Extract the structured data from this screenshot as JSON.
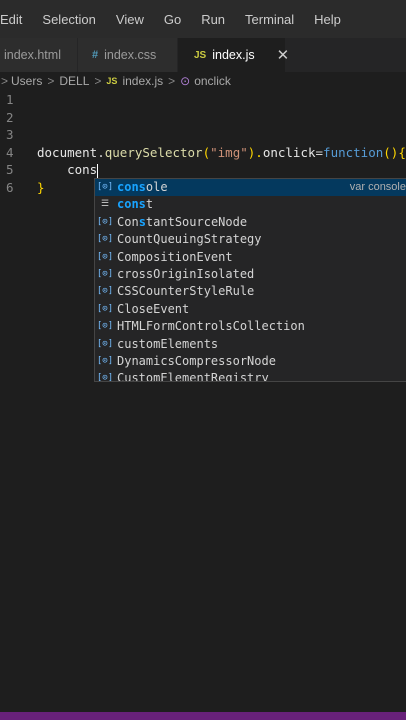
{
  "menubar": {
    "items": [
      "Edit",
      "Selection",
      "View",
      "Go",
      "Run",
      "Terminal",
      "Help"
    ]
  },
  "tabs": [
    {
      "label": "index.html",
      "icon": "",
      "active": false
    },
    {
      "label": "index.css",
      "icon": "#",
      "active": false
    },
    {
      "label": "index.js",
      "icon": "JS",
      "active": true,
      "close": "✕"
    }
  ],
  "breadcrumb": {
    "lead": ">",
    "parts": [
      "Users",
      "DELL",
      "index.js",
      "onclick"
    ],
    "sep": ">",
    "js_icon": "JS",
    "fn_icon": "⊙"
  },
  "editor": {
    "line_numbers": [
      "1",
      "2",
      "3",
      "4",
      "5",
      "6"
    ],
    "line4": {
      "t1": "document",
      "t2": ".",
      "t3": "querySelector",
      "t4": "(",
      "t5": "\"img\"",
      "t6": ").",
      "t7": "onclick",
      "t8": "=",
      "t9": "function",
      "t10": "()",
      "t11": "{"
    },
    "line5": "    cons",
    "line6": "}"
  },
  "suggest": {
    "items": [
      {
        "match": "cons",
        "rest": "ole",
        "icon": "[⊙]",
        "kind": "var",
        "detail": "var console"
      },
      {
        "match": "cons",
        "rest": "t",
        "icon": "☰",
        "kind": "keyword",
        "detail": ""
      },
      {
        "pre": "Con",
        "match": "s",
        "mid": "tantSourceNode",
        "icon": "[⊙]"
      },
      {
        "text": "CountQueuingStrategy",
        "icon": "[⊙]"
      },
      {
        "text": "CompositionEvent",
        "icon": "[⊙]"
      },
      {
        "text": "crossOriginIsolated",
        "icon": "[⊙]"
      },
      {
        "text": "CSSCounterStyleRule",
        "icon": "[⊙]"
      },
      {
        "text": "CloseEvent",
        "icon": "[⊙]"
      },
      {
        "text": "HTMLFormControlsCollection",
        "icon": "[⊙]"
      },
      {
        "text": "customElements",
        "icon": "[⊙]"
      },
      {
        "text": "DynamicsCompressorNode",
        "icon": "[⊙]"
      },
      {
        "text": "CustomElementRegistry",
        "icon": "[⊙]"
      }
    ]
  },
  "colors": {
    "status_bar": "#68217a",
    "selection": "#04395e",
    "match_highlight": "#18a3ff"
  }
}
